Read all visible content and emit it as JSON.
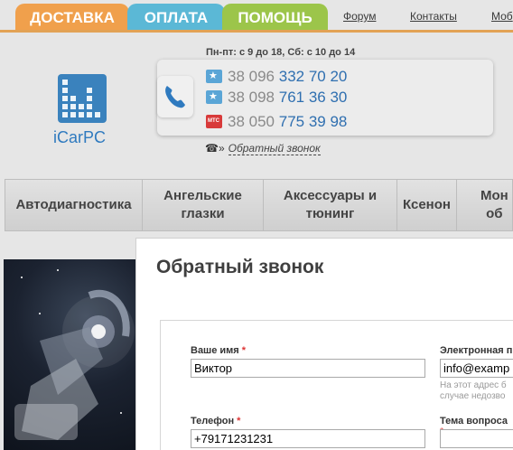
{
  "top_tabs": [
    {
      "label": "ДОСТАВКА",
      "color": "#f0a04c"
    },
    {
      "label": "ОПЛАТА",
      "color": "#5bb8d6"
    },
    {
      "label": "ПОМОЩЬ",
      "color": "#9cc54a"
    }
  ],
  "top_links": [
    "Форум",
    "Контакты",
    "Моб"
  ],
  "logo": {
    "text": "iCarPC"
  },
  "hours": "Пн-пт: с 9 до 18, Сб: с 10 до 14",
  "phones": [
    {
      "prefix": "38 096",
      "number": "332 70 20",
      "operator_icon": "kyivstar-icon"
    },
    {
      "prefix": "38 098",
      "number": "761 36 30",
      "operator_icon": "kyivstar-icon"
    },
    {
      "prefix": "38 050",
      "number": "775 39 98",
      "operator_icon": "mts-icon"
    }
  ],
  "callback": {
    "arrow": "»",
    "label": "Обратный звонок"
  },
  "nav": [
    {
      "line1": "Автодиагностика",
      "line2": ""
    },
    {
      "line1": "Ангельские",
      "line2": "глазки"
    },
    {
      "line1": "Аксессуары и",
      "line2": "тюнинг"
    },
    {
      "line1": "Ксенон",
      "line2": ""
    },
    {
      "line1": "Мон",
      "line2": "об"
    }
  ],
  "modal": {
    "title": "Обратный звонок",
    "name_label": "Ваше имя",
    "name_value": "Виктор",
    "email_label": "Электронная п",
    "email_value": "info@examp",
    "email_help_1": "На этот адрес б",
    "email_help_2": "случае недозво",
    "phone_label": "Телефон",
    "phone_value": "+79171231231",
    "topic_label": "Тема вопроса",
    "topic_value": "",
    "required_mark": "*"
  },
  "colors": {
    "accent_orange": "#e2a255",
    "phone_blue": "#2f6fb0",
    "logo_blue": "#3a82bd"
  }
}
